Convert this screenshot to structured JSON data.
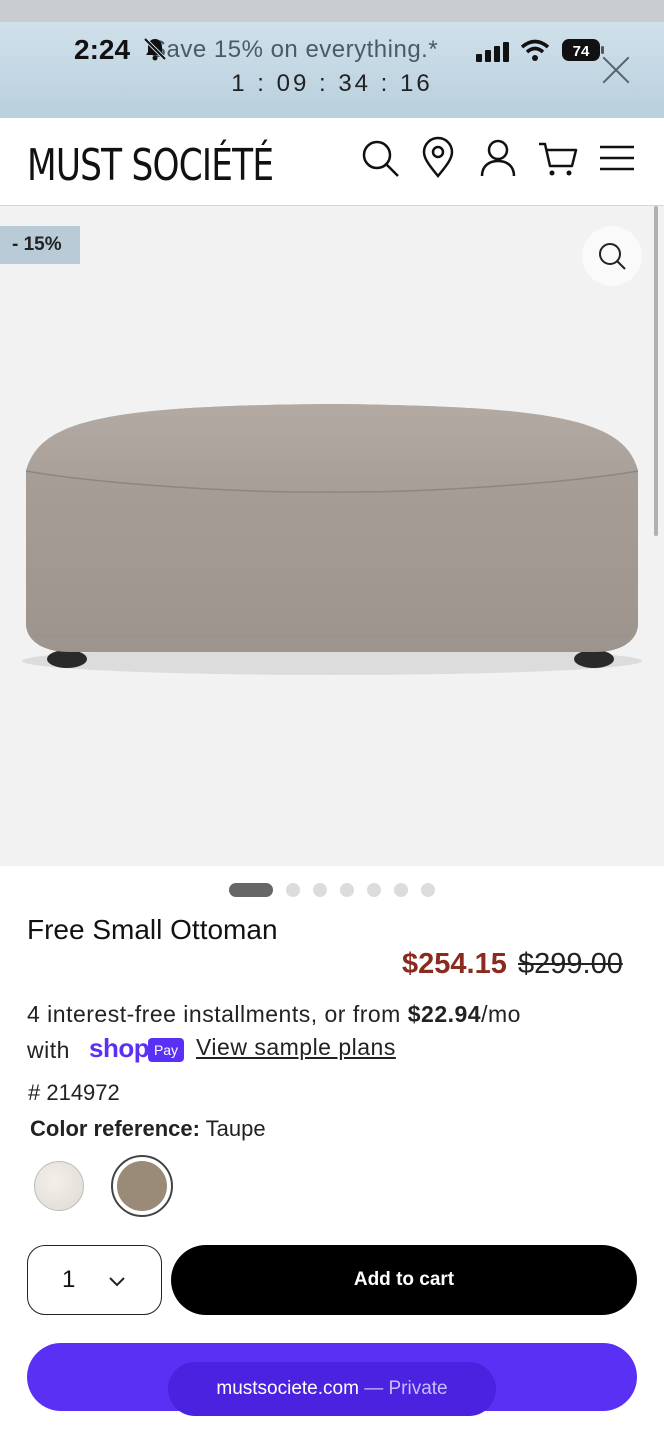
{
  "status_bar": {
    "time": "2:24",
    "battery": "74"
  },
  "promo": {
    "text": "Save 15% on everything.*",
    "countdown": "1 : 09 : 34 : 16"
  },
  "header": {
    "logo": "MUST SOCIÉTÉ"
  },
  "product": {
    "discount_badge": "- 15%",
    "title": "Free Small Ottoman",
    "sale_price": "$254.15",
    "original_price": "$299.00",
    "installments_prefix": "4 interest-free installments, or from ",
    "installments_amount": "$22.94",
    "installments_suffix": "/mo",
    "with": "with",
    "shop_word": "shop",
    "pay_badge": "Pay",
    "sample_plans_link": "View sample plans",
    "sku": "# 214972",
    "color_label": "Color reference:",
    "color_value": "Taupe",
    "image_pages": 7,
    "active_image": 1
  },
  "purchase": {
    "quantity": "1",
    "add_to_cart": "Add to cart"
  },
  "browser": {
    "domain": "mustsociete.com",
    "private_label": " — Private"
  },
  "colors": {
    "sale_red": "#8b2a1f",
    "shop_purple": "#5a31f4",
    "badge_blue": "#b8cbd6",
    "taupe": "#9a8a78"
  }
}
